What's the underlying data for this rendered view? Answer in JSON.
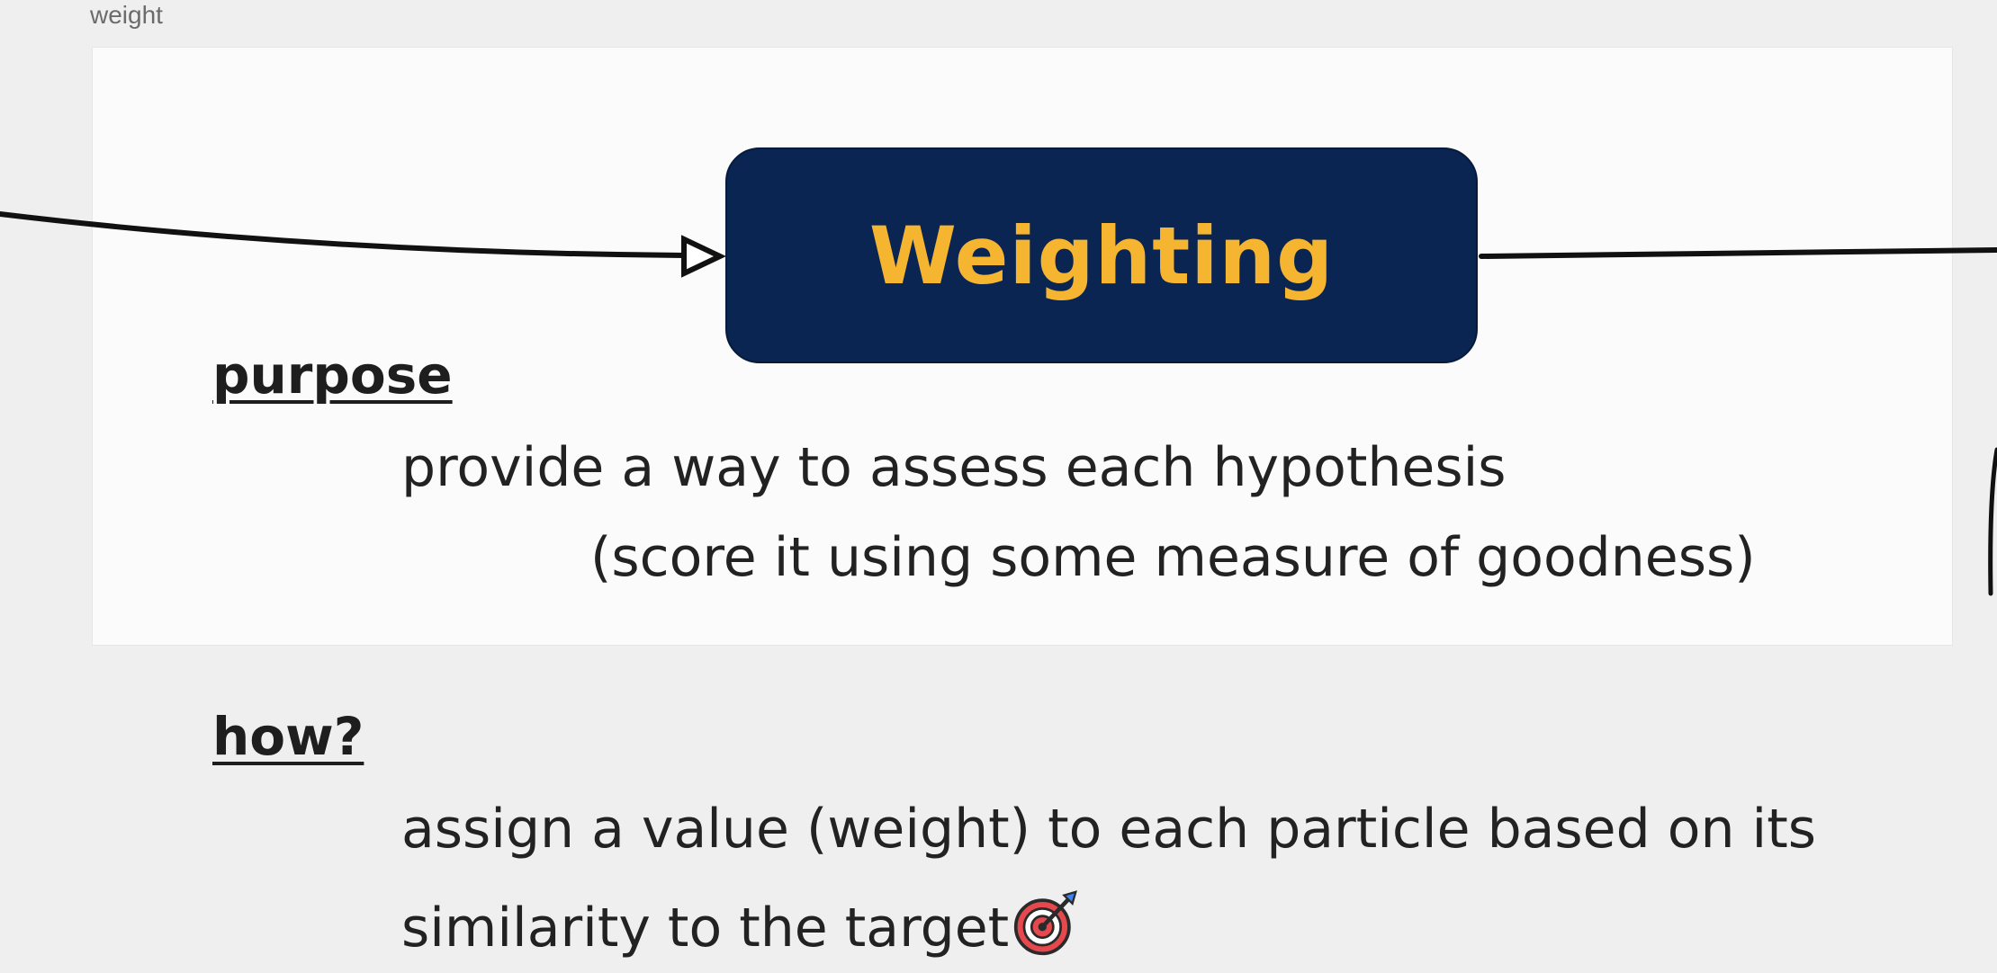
{
  "frame": {
    "label": "weight"
  },
  "node": {
    "title": "Weighting",
    "fill_color": "#0a2551",
    "text_color": "#f6b531"
  },
  "purpose": {
    "heading": "purpose",
    "line1": "provide a way to assess each hypothesis",
    "line2": "(score it using some measure of goodness)"
  },
  "how": {
    "heading": "how?",
    "line1": "assign a value (weight) to each particle based on its",
    "line2": "similarity to the target"
  },
  "icons": {
    "inline_emoji": "target-icon"
  }
}
